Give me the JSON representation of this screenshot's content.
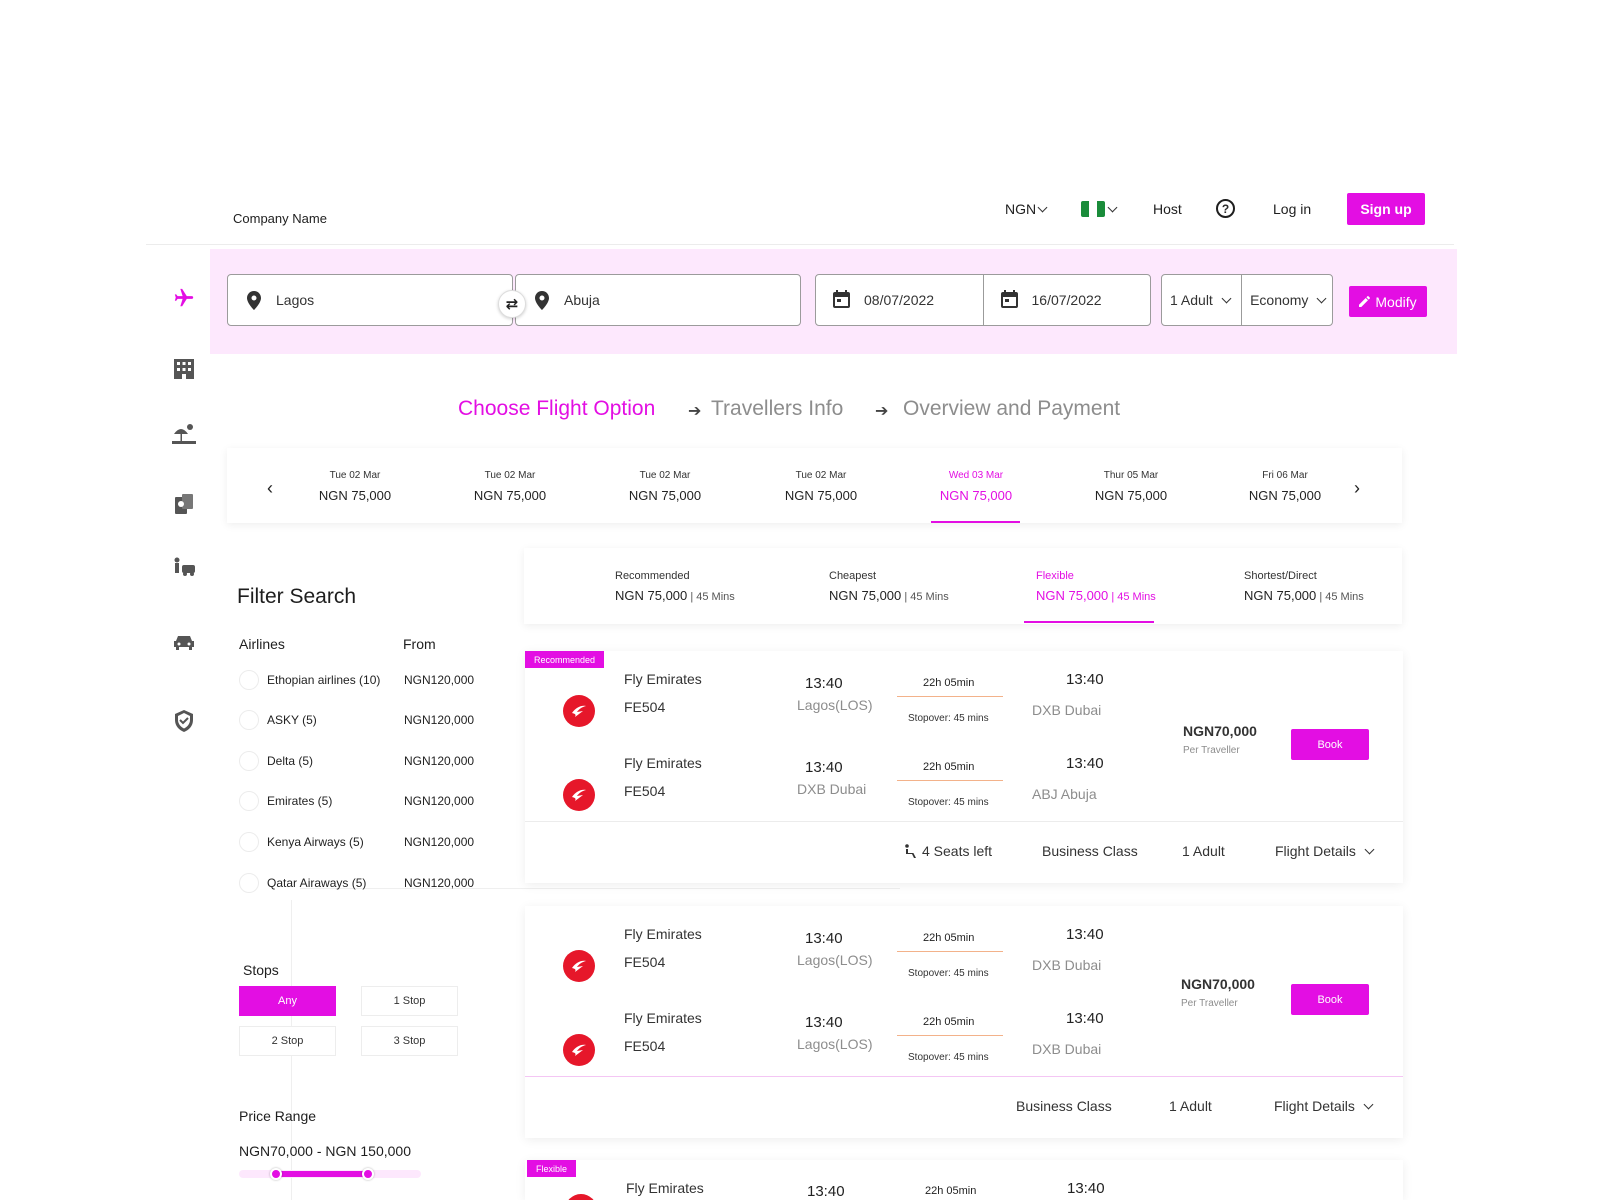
{
  "header": {
    "company": "Company Name",
    "currency": "NGN",
    "host": "Host",
    "help": "?",
    "login": "Log in",
    "signup": "Sign up",
    "flag_colors": [
      "#1a8c3a",
      "#ffffff",
      "#1a8c3a"
    ]
  },
  "search": {
    "from": "Lagos",
    "to": "Abuja",
    "depart_date": "08/07/2022",
    "return_date": "16/07/2022",
    "passengers": "1 Adult",
    "cabin": "Economy",
    "modify": "Modify",
    "swap_icon": "⇄"
  },
  "sidebar_icons": [
    "flight-icon",
    "hotel-icon",
    "holiday-icon",
    "visa-icon",
    "airport-transfer-icon",
    "car-rental-icon",
    "insurance-icon"
  ],
  "steps": {
    "step1": "Choose Flight Option",
    "step2": "Travellers Info",
    "step3": "Overview and Payment",
    "arrow": "➔"
  },
  "date_strip": {
    "prev": "‹",
    "next": "›",
    "days": [
      {
        "date": "Tue 02 Mar",
        "price": "NGN 75,000"
      },
      {
        "date": "Tue 02 Mar",
        "price": "NGN 75,000"
      },
      {
        "date": "Tue 02 Mar",
        "price": "NGN 75,000"
      },
      {
        "date": "Tue 02 Mar",
        "price": "NGN 75,000"
      },
      {
        "date": "Wed 03 Mar",
        "price": "NGN 75,000"
      },
      {
        "date": "Thur 05 Mar",
        "price": "NGN 75,000"
      },
      {
        "date": "Fri 06 Mar",
        "price": "NGN 75,000"
      }
    ]
  },
  "filter": {
    "title": "Filter Search",
    "airlines_header": "Airlines",
    "from_header": "From",
    "airlines": [
      {
        "name": "Ethopian airlines (10)",
        "price": "NGN120,000"
      },
      {
        "name": "ASKY (5)",
        "price": "NGN120,000"
      },
      {
        "name": "Delta (5)",
        "price": "NGN120,000"
      },
      {
        "name": "Emirates (5)",
        "price": "NGN120,000"
      },
      {
        "name": "Kenya Airways (5)",
        "price": "NGN120,000"
      },
      {
        "name": "Qatar Airaways (5)",
        "price": "NGN120,000"
      }
    ],
    "stops_header": "Stops",
    "stops": [
      "Any",
      "1 Stop",
      "2 Stop",
      "3 Stop"
    ],
    "price_header": "Price Range",
    "price_range": "NGN70,000 - NGN 150,000"
  },
  "sort_tabs": [
    {
      "label": "Recommended",
      "price": "NGN 75,000",
      "dur": " | 45 Mins"
    },
    {
      "label": "Cheapest",
      "price": "NGN 75,000",
      "dur": " | 45 Mins"
    },
    {
      "label": "Flexible",
      "price": "NGN 75,000",
      "dur": " | 45 Mins"
    },
    {
      "label": "Shortest/Direct",
      "price": "NGN 75,000",
      "dur": " | 45 Mins"
    }
  ],
  "cards": [
    {
      "badge": "Recommended",
      "legs": [
        {
          "airline": "Fly Emirates",
          "flight_no": "FE504",
          "dep_time": "13:40",
          "dep_city": "Lagos(LOS)",
          "duration": "22h 05min",
          "stopover": "Stopover: 45 mins",
          "arr_time": "13:40",
          "arr_city": "DXB Dubai"
        },
        {
          "airline": "Fly Emirates",
          "flight_no": "FE504",
          "dep_time": "13:40",
          "dep_city": "DXB Dubai",
          "duration": "22h 05min",
          "stopover": "Stopover: 45 mins",
          "arr_time": "13:40",
          "arr_city": "ABJ Abuja"
        }
      ],
      "price": "NGN70,000",
      "per": "Per Traveller",
      "book": "Book",
      "seats": "4 Seats left",
      "class": "Business Class",
      "adults": "1 Adult",
      "details": "Flight Details"
    },
    {
      "legs": [
        {
          "airline": "Fly Emirates",
          "flight_no": "FE504",
          "dep_time": "13:40",
          "dep_city": "Lagos(LOS)",
          "duration": "22h 05min",
          "stopover": "Stopover: 45 mins",
          "arr_time": "13:40",
          "arr_city": "DXB Dubai"
        },
        {
          "airline": "Fly Emirates",
          "flight_no": "FE504",
          "dep_time": "13:40",
          "dep_city": "Lagos(LOS)",
          "duration": "22h 05min",
          "stopover": "Stopover: 45 mins",
          "arr_time": "13:40",
          "arr_city": "DXB Dubai"
        }
      ],
      "price": "NGN70,000",
      "per": "Per Traveller",
      "book": "Book",
      "class": "Business Class",
      "adults": "1 Adult",
      "details": "Flight Details"
    },
    {
      "badge": "Flexible",
      "legs": [
        {
          "airline": "Fly Emirates",
          "dep_time": "13:40",
          "duration": "22h 05min",
          "arr_time": "13:40"
        }
      ]
    }
  ],
  "colors": {
    "accent": "#e30ee3",
    "band": "#fde8fd",
    "airline_logo": "#e6172a"
  }
}
